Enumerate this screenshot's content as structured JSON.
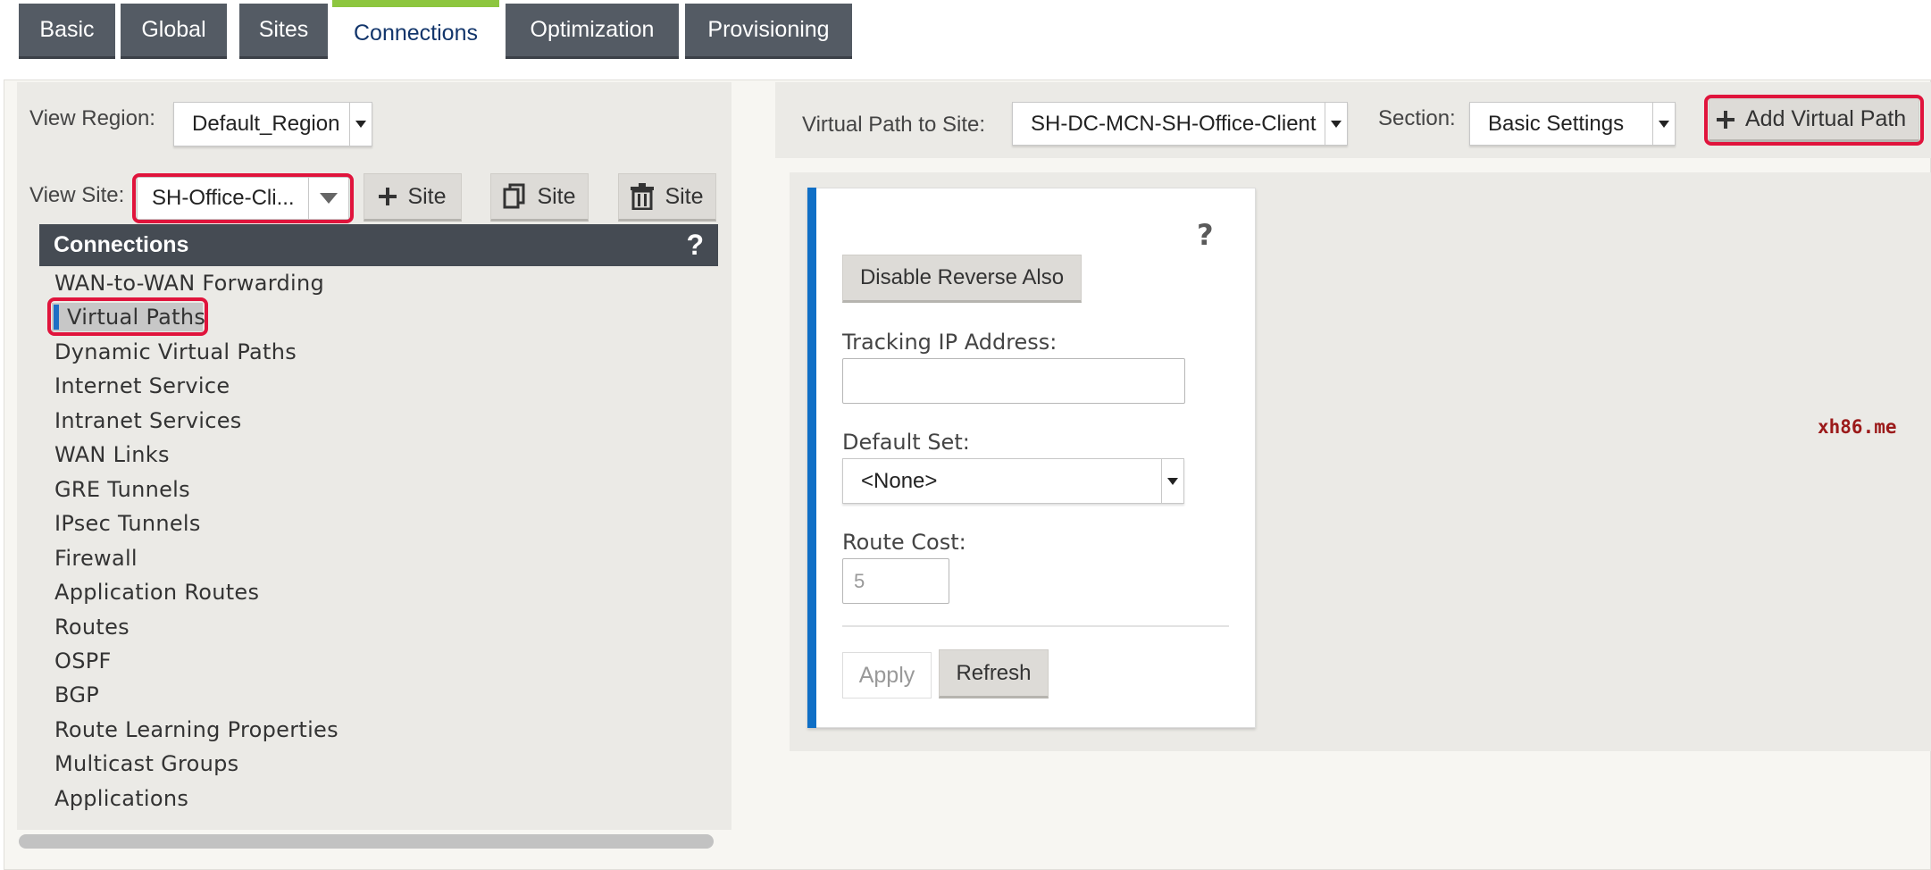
{
  "tabs": [
    {
      "label": "Basic",
      "active": false
    },
    {
      "label": "Global",
      "active": false
    },
    {
      "label": "Sites",
      "active": false
    },
    {
      "label": "Connections",
      "active": true
    },
    {
      "label": "Optimization",
      "active": false
    },
    {
      "label": "Provisioning",
      "active": false
    }
  ],
  "left": {
    "view_region_label": "View Region:",
    "view_region_value": "Default_Region",
    "view_site_label": "View Site:",
    "view_site_value": "SH-Office-Cli...",
    "add_site_label": "Site",
    "copy_site_label": "Site",
    "delete_site_label": "Site",
    "connections_title": "Connections",
    "help_glyph": "?",
    "nav_items": [
      "WAN-to-WAN Forwarding",
      "Virtual Paths",
      "Dynamic Virtual Paths",
      "Internet Service",
      "Intranet Services",
      "WAN Links",
      "GRE Tunnels",
      "IPsec Tunnels",
      "Firewall",
      "Application Routes",
      "Routes",
      "OSPF",
      "BGP",
      "Route Learning Properties",
      "Multicast Groups",
      "Applications"
    ],
    "selected_nav": "Virtual Paths"
  },
  "right": {
    "virtual_path_label": "Virtual Path to Site:",
    "virtual_path_value": "SH-DC-MCN-SH-Office-Client",
    "section_label": "Section:",
    "section_value": "Basic Settings",
    "add_virtual_path_label": "Add Virtual Path"
  },
  "form": {
    "help_glyph": "?",
    "disable_reverse_label": "Disable Reverse Also",
    "tracking_ip_label": "Tracking IP Address:",
    "tracking_ip_value": "",
    "default_set_label": "Default Set:",
    "default_set_value": "<None>",
    "route_cost_label": "Route Cost:",
    "route_cost_value": "5",
    "apply_label": "Apply",
    "refresh_label": "Refresh"
  },
  "watermark": "xh86.me",
  "colors": {
    "tab_bg": "#545b64",
    "tab_active_accent": "#8dc63f",
    "header_dark": "#454b53",
    "highlight_red": "#e0143c",
    "card_accent_blue": "#0f6fc6",
    "selected_marker_blue": "#1e6fc5"
  }
}
